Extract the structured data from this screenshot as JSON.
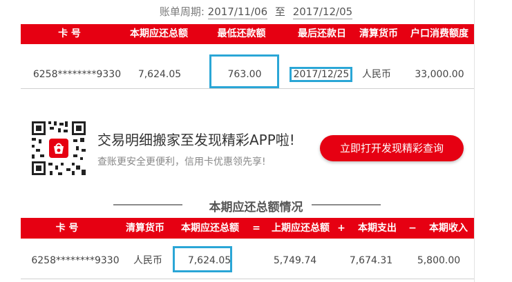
{
  "period": {
    "label": "账单周期:",
    "start": "2017/11/06",
    "to": "至",
    "end": "2017/12/05"
  },
  "summary_table": {
    "headers": [
      "卡 号",
      "本期应还总额",
      "最低还款额",
      "最后还款日",
      "清算货币",
      "户口消费额度"
    ],
    "row": [
      "6258********9330",
      "7,624.05",
      "763.00",
      "2017/12/25",
      "人民币",
      "33,000.00"
    ]
  },
  "promo": {
    "title": "交易明细搬家至发现精彩APP啦!",
    "subtitle": "查账更安全更便利，信用卡优惠领先享!",
    "button": "立即打开发现精彩查询",
    "icon": "qr-code-icon"
  },
  "detail_section": {
    "title": "本期应还总额情况",
    "headers": [
      "卡 号",
      "清算货币",
      "本期应还总额",
      "=",
      "上期应还总额",
      "+",
      "本期支出",
      "−",
      "本期收入"
    ],
    "row": [
      "6258********9330",
      "人民币",
      "7,624.05",
      "5,749.74",
      "7,674.31",
      "5,800.00"
    ]
  },
  "colors": {
    "brand_red": "#e60012",
    "highlight_blue": "#2aa6d6"
  }
}
